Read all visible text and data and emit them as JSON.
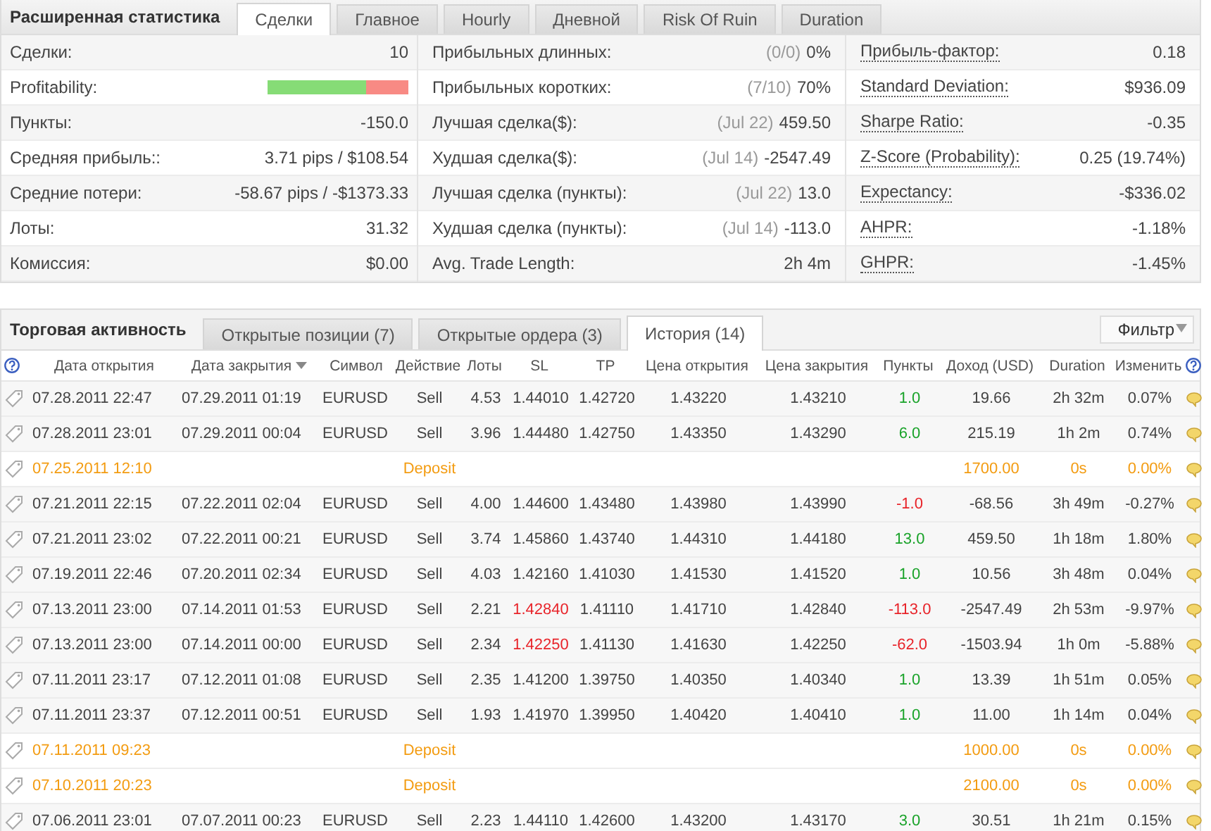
{
  "stats_panel": {
    "title": "Расширенная статистика",
    "tabs": [
      {
        "label": "Сделки",
        "selected": true
      },
      {
        "label": "Главное",
        "selected": false
      },
      {
        "label": "Hourly",
        "selected": false
      },
      {
        "label": "Дневной",
        "selected": false
      },
      {
        "label": "Risk Of Ruin",
        "selected": false
      },
      {
        "label": "Duration",
        "selected": false
      }
    ],
    "column_1": [
      {
        "label": "Сделки:",
        "value": "10"
      },
      {
        "label": "Profitability:",
        "kind": "bar",
        "level": 0.7
      },
      {
        "label": "Пункты:",
        "value": "-150.0"
      },
      {
        "label": "Средняя прибыль::",
        "value": "3.71 pips / $108.54"
      },
      {
        "label": "Средние потери:",
        "value": "-58.67 pips / -$1373.33"
      },
      {
        "label": "Лоты:",
        "value": "31.32"
      },
      {
        "label": "Комиссия:",
        "value": "$0.00"
      }
    ],
    "column_2": [
      {
        "label": "Прибыльных длинных:",
        "note": "(0/0)",
        "value": "0%"
      },
      {
        "label": "Прибыльных коротких:",
        "note": "(7/10)",
        "value": "70%"
      },
      {
        "label": "Лучшая сделка($):",
        "note": "(Jul 22)",
        "value": "459.50"
      },
      {
        "label": "Худшая сделка($):",
        "note": "(Jul 14)",
        "value": "-2547.49"
      },
      {
        "label": "Лучшая сделка (пункты):",
        "note": "(Jul 22)",
        "value": "13.0"
      },
      {
        "label": "Худшая сделка (пункты):",
        "note": "(Jul 14)",
        "value": "-113.0"
      },
      {
        "label": "Avg. Trade Length:",
        "value": "2h 4m"
      }
    ],
    "column_3": [
      {
        "label": "Прибыль-фактор:",
        "value": "0.18"
      },
      {
        "label": "Standard Deviation:",
        "value": "$936.09"
      },
      {
        "label": "Sharpe Ratio:",
        "value": "-0.35"
      },
      {
        "label": "Z-Score (Probability):",
        "value": "0.25 (19.74%)"
      },
      {
        "label": "Expectancy:",
        "value": "-$336.02"
      },
      {
        "label": "AHPR:",
        "value": "-1.18%"
      },
      {
        "label": "GHPR:",
        "value": "-1.45%"
      }
    ]
  },
  "activity_panel": {
    "title": "Торговая активность",
    "tabs": [
      {
        "label": "Открытые позиции (7)",
        "selected": false
      },
      {
        "label": "Открытые ордера (3)",
        "selected": false
      },
      {
        "label": "История (14)",
        "selected": true
      }
    ],
    "filter_button": "Фильтр",
    "columns": [
      "Дата открытия",
      "Дата закрытия",
      "Символ",
      "Действие",
      "Лоты",
      "SL",
      "TP",
      "Цена открытия",
      "Цена закрытия",
      "Пункты",
      "Доход (USD)",
      "Duration",
      "Изменить"
    ],
    "rows": [
      {
        "kind": "trade",
        "open": "07.28.2011 22:47",
        "close": "07.29.2011 01:19",
        "symbol": "EURUSD",
        "action": "Sell",
        "lots": "4.53",
        "sl": "1.44010",
        "sl_hit": false,
        "tp": "1.42720",
        "open_price": "1.43220",
        "close_price": "1.43210",
        "pips": "1.0",
        "loss": false,
        "income": "19.66",
        "duration": "2h 32m",
        "change": "0.07%"
      },
      {
        "kind": "trade",
        "open": "07.28.2011 23:01",
        "close": "07.29.2011 00:04",
        "symbol": "EURUSD",
        "action": "Sell",
        "lots": "3.96",
        "sl": "1.44480",
        "sl_hit": false,
        "tp": "1.42750",
        "open_price": "1.43350",
        "close_price": "1.43290",
        "pips": "6.0",
        "loss": false,
        "income": "215.19",
        "duration": "1h 2m",
        "change": "0.74%"
      },
      {
        "kind": "deposit",
        "open": "07.25.2011 12:10",
        "action": "Deposit",
        "income": "1700.00",
        "duration": "0s",
        "change": "0.00%"
      },
      {
        "kind": "trade",
        "open": "07.21.2011 22:15",
        "close": "07.22.2011 02:04",
        "symbol": "EURUSD",
        "action": "Sell",
        "lots": "4.00",
        "sl": "1.44600",
        "sl_hit": false,
        "tp": "1.43480",
        "open_price": "1.43980",
        "close_price": "1.43990",
        "pips": "-1.0",
        "loss": true,
        "income": "-68.56",
        "duration": "3h 49m",
        "change": "-0.27%"
      },
      {
        "kind": "trade",
        "open": "07.21.2011 23:02",
        "close": "07.22.2011 00:21",
        "symbol": "EURUSD",
        "action": "Sell",
        "lots": "3.74",
        "sl": "1.45860",
        "sl_hit": false,
        "tp": "1.43740",
        "open_price": "1.44310",
        "close_price": "1.44180",
        "pips": "13.0",
        "loss": false,
        "income": "459.50",
        "duration": "1h 18m",
        "change": "1.80%"
      },
      {
        "kind": "trade",
        "open": "07.19.2011 22:46",
        "close": "07.20.2011 02:34",
        "symbol": "EURUSD",
        "action": "Sell",
        "lots": "4.03",
        "sl": "1.42160",
        "sl_hit": false,
        "tp": "1.41030",
        "open_price": "1.41530",
        "close_price": "1.41520",
        "pips": "1.0",
        "loss": false,
        "income": "10.56",
        "duration": "3h 48m",
        "change": "0.04%"
      },
      {
        "kind": "trade",
        "open": "07.13.2011 23:00",
        "close": "07.14.2011 01:53",
        "symbol": "EURUSD",
        "action": "Sell",
        "lots": "2.21",
        "sl": "1.42840",
        "sl_hit": true,
        "tp": "1.41110",
        "open_price": "1.41710",
        "close_price": "1.42840",
        "pips": "-113.0",
        "loss": true,
        "income": "-2547.49",
        "duration": "2h 53m",
        "change": "-9.97%"
      },
      {
        "kind": "trade",
        "open": "07.13.2011 23:00",
        "close": "07.14.2011 00:00",
        "symbol": "EURUSD",
        "action": "Sell",
        "lots": "2.34",
        "sl": "1.42250",
        "sl_hit": true,
        "tp": "1.41130",
        "open_price": "1.41630",
        "close_price": "1.42250",
        "pips": "-62.0",
        "loss": true,
        "income": "-1503.94",
        "duration": "1h 0m",
        "change": "-5.88%"
      },
      {
        "kind": "trade",
        "open": "07.11.2011 23:17",
        "close": "07.12.2011 01:08",
        "symbol": "EURUSD",
        "action": "Sell",
        "lots": "2.35",
        "sl": "1.41200",
        "sl_hit": false,
        "tp": "1.39750",
        "open_price": "1.40350",
        "close_price": "1.40340",
        "pips": "1.0",
        "loss": false,
        "income": "13.39",
        "duration": "1h 51m",
        "change": "0.05%"
      },
      {
        "kind": "trade",
        "open": "07.11.2011 23:37",
        "close": "07.12.2011 00:51",
        "symbol": "EURUSD",
        "action": "Sell",
        "lots": "1.93",
        "sl": "1.41970",
        "sl_hit": false,
        "tp": "1.39950",
        "open_price": "1.40420",
        "close_price": "1.40410",
        "pips": "1.0",
        "loss": false,
        "income": "11.00",
        "duration": "1h 14m",
        "change": "0.04%"
      },
      {
        "kind": "deposit",
        "open": "07.11.2011 09:23",
        "action": "Deposit",
        "income": "1000.00",
        "duration": "0s",
        "change": "0.00%"
      },
      {
        "kind": "deposit",
        "open": "07.10.2011 20:23",
        "action": "Deposit",
        "income": "2100.00",
        "duration": "0s",
        "change": "0.00%"
      },
      {
        "kind": "trade",
        "open": "07.06.2011 23:01",
        "close": "07.07.2011 00:23",
        "symbol": "EURUSD",
        "action": "Sell",
        "lots": "2.23",
        "sl": "1.44110",
        "sl_hit": false,
        "tp": "1.42600",
        "open_price": "1.43200",
        "close_price": "1.43170",
        "pips": "3.0",
        "loss": false,
        "income": "30.51",
        "duration": "1h 21m",
        "change": "0.15%"
      }
    ]
  }
}
